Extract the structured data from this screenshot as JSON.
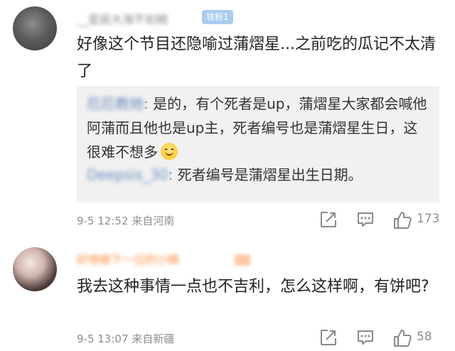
{
  "comments": [
    {
      "username": "__星辰大海不如楠",
      "fan_badge": "铁粉1",
      "fan_badge_hidden": "...",
      "content": "好像这个节目还隐喻过蒲熠星...之前吃的瓜记不太清了",
      "replies": [
        {
          "name": "厄厄教她",
          "text": "是的，有个死者是up，蒲熠星大家都会喊他阿蒲而且他也是up主，死者编号也是蒲熠星生日，这很难不想多",
          "emoji": "smile-emoji"
        },
        {
          "name": "Deepsis_30",
          "text": "死者编号是蒲熠星出生日期。"
        }
      ],
      "timestamp": "9-5 12:52",
      "location": "来自河南",
      "like_count": "173"
    },
    {
      "username": "好想做下一位的小楠",
      "content": "我去这种事情一点也不吉利，怎么这样啊，有饼吧?",
      "timestamp": "9-5 13:07",
      "location": "来自新疆",
      "like_count": "58"
    }
  ],
  "colors": {
    "reply_name": "#6a8fc0",
    "meta": "#8e8e8e",
    "reply_bg": "#f1f1f1",
    "fan_badge": "#a9cdee"
  },
  "icons": [
    "share-icon",
    "comment-icon",
    "like-icon"
  ]
}
